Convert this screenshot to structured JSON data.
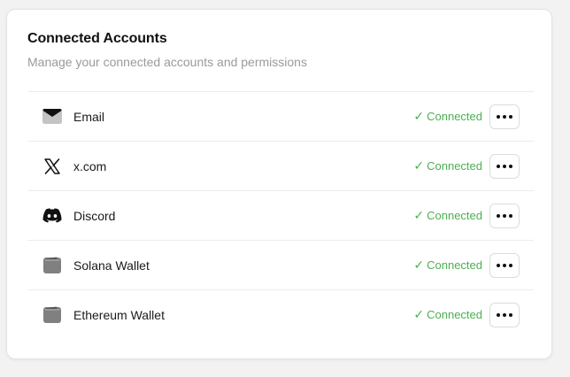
{
  "card": {
    "title": "Connected Accounts",
    "subtitle": "Manage your connected accounts and permissions"
  },
  "accounts": [
    {
      "name": "Email",
      "icon": "envelope-icon",
      "status": "Connected"
    },
    {
      "name": "x.com",
      "icon": "x-logo-icon",
      "status": "Connected"
    },
    {
      "name": "Discord",
      "icon": "discord-icon",
      "status": "Connected"
    },
    {
      "name": "Solana Wallet",
      "icon": "wallet-icon",
      "status": "Connected"
    },
    {
      "name": "Ethereum Wallet",
      "icon": "wallet-icon",
      "status": "Connected"
    }
  ],
  "colors": {
    "connected": "#4caf50",
    "icon_gray": "#808080"
  },
  "check_glyph": "✓"
}
